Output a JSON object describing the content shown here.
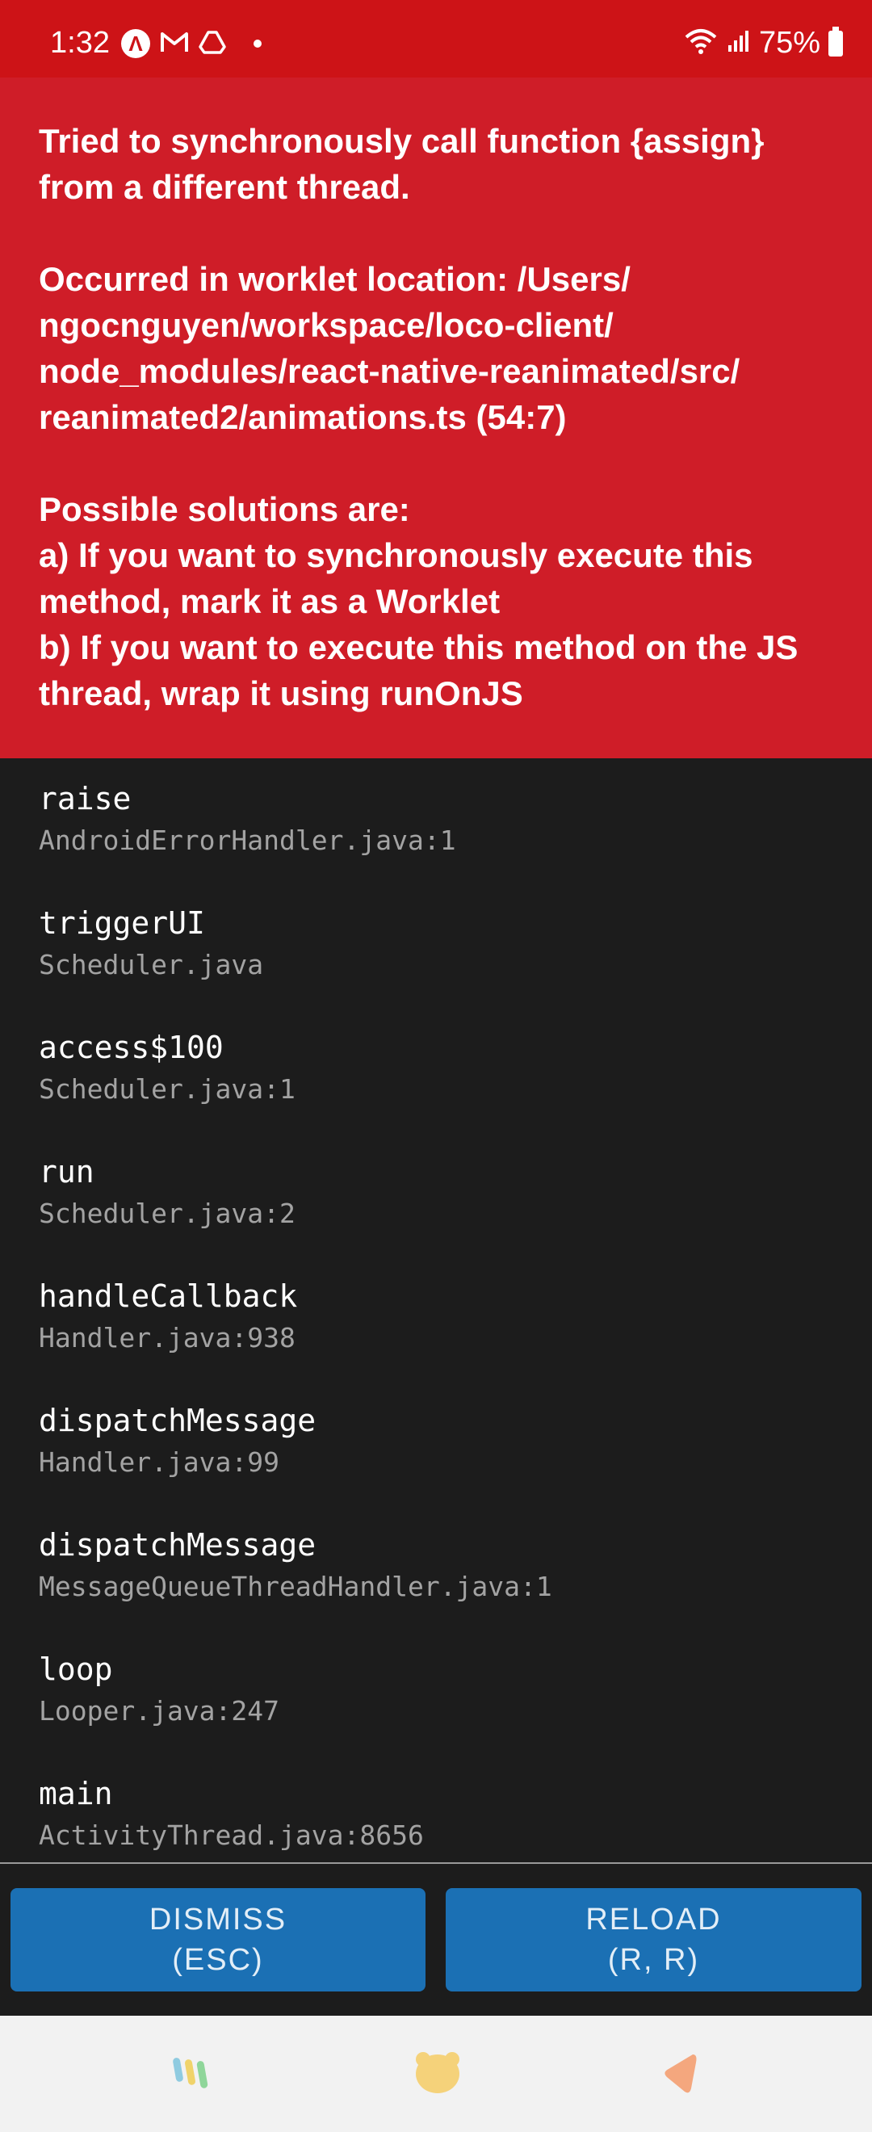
{
  "status_bar": {
    "time": "1:32",
    "battery": "75%",
    "icons": [
      "app-a-icon",
      "gmail-icon",
      "drive-icon",
      "wifi-icon",
      "signal-icon",
      "battery-icon"
    ]
  },
  "error": {
    "message": "Tried to synchronously call function {assign} from a different thread.\n\nOccurred in worklet location: /Users/\nngocnguyen/workspace/loco-client/\nnode_modules/react-native-reanimated/src/\nreanimated2/animations.ts (54:7)\n\nPossible solutions are:\na) If you want to synchronously execute this method, mark it as a Worklet\nb) If you want to execute this method on the JS thread, wrap it using runOnJS"
  },
  "stack": [
    {
      "method": "raise",
      "file": "AndroidErrorHandler.java:1"
    },
    {
      "method": "triggerUI",
      "file": "Scheduler.java"
    },
    {
      "method": "access$100",
      "file": "Scheduler.java:1"
    },
    {
      "method": "run",
      "file": "Scheduler.java:2"
    },
    {
      "method": "handleCallback",
      "file": "Handler.java:938"
    },
    {
      "method": "dispatchMessage",
      "file": "Handler.java:99"
    },
    {
      "method": "dispatchMessage",
      "file": "MessageQueueThreadHandler.java:1"
    },
    {
      "method": "loop",
      "file": "Looper.java:247"
    },
    {
      "method": "main",
      "file": "ActivityThread.java:8656"
    }
  ],
  "buttons": {
    "dismiss": {
      "line1": "DISMISS",
      "line2": "(ESC)"
    },
    "reload": {
      "line1": "RELOAD",
      "line2": "(R, R)"
    }
  },
  "nav": {
    "icons": [
      "recent-apps-icon",
      "home-icon",
      "back-icon"
    ]
  },
  "colors": {
    "status_bar": "#cd1317",
    "error_header": "#cf1d28",
    "stack_bg": "#1c1c1c",
    "button": "#1b70b4"
  }
}
